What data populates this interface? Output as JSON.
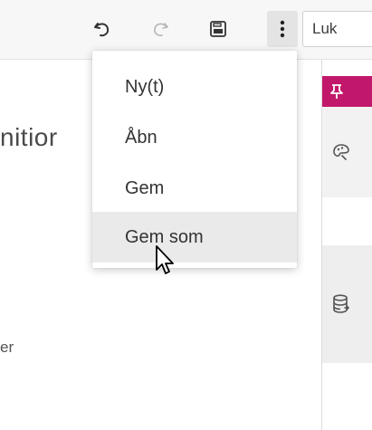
{
  "toolbar": {
    "undo_icon": "undo-icon",
    "redo_icon": "redo-icon",
    "save_icon": "save-icon",
    "more_icon": "kebab-menu-icon",
    "close_label": "Luk"
  },
  "content": {
    "heading_fragment": "nitior",
    "small_text_fragment": "er"
  },
  "side_panel": {
    "pin_icon": "pin-icon",
    "accent_color": "#c2186b",
    "items": [
      {
        "icon": "palette-icon"
      },
      {
        "icon": "database-icon"
      }
    ]
  },
  "menu": {
    "items": [
      {
        "label": "Ny(t)"
      },
      {
        "label": "Åbn"
      },
      {
        "label": "Gem"
      },
      {
        "label": "Gem som",
        "hovered": true
      }
    ]
  }
}
